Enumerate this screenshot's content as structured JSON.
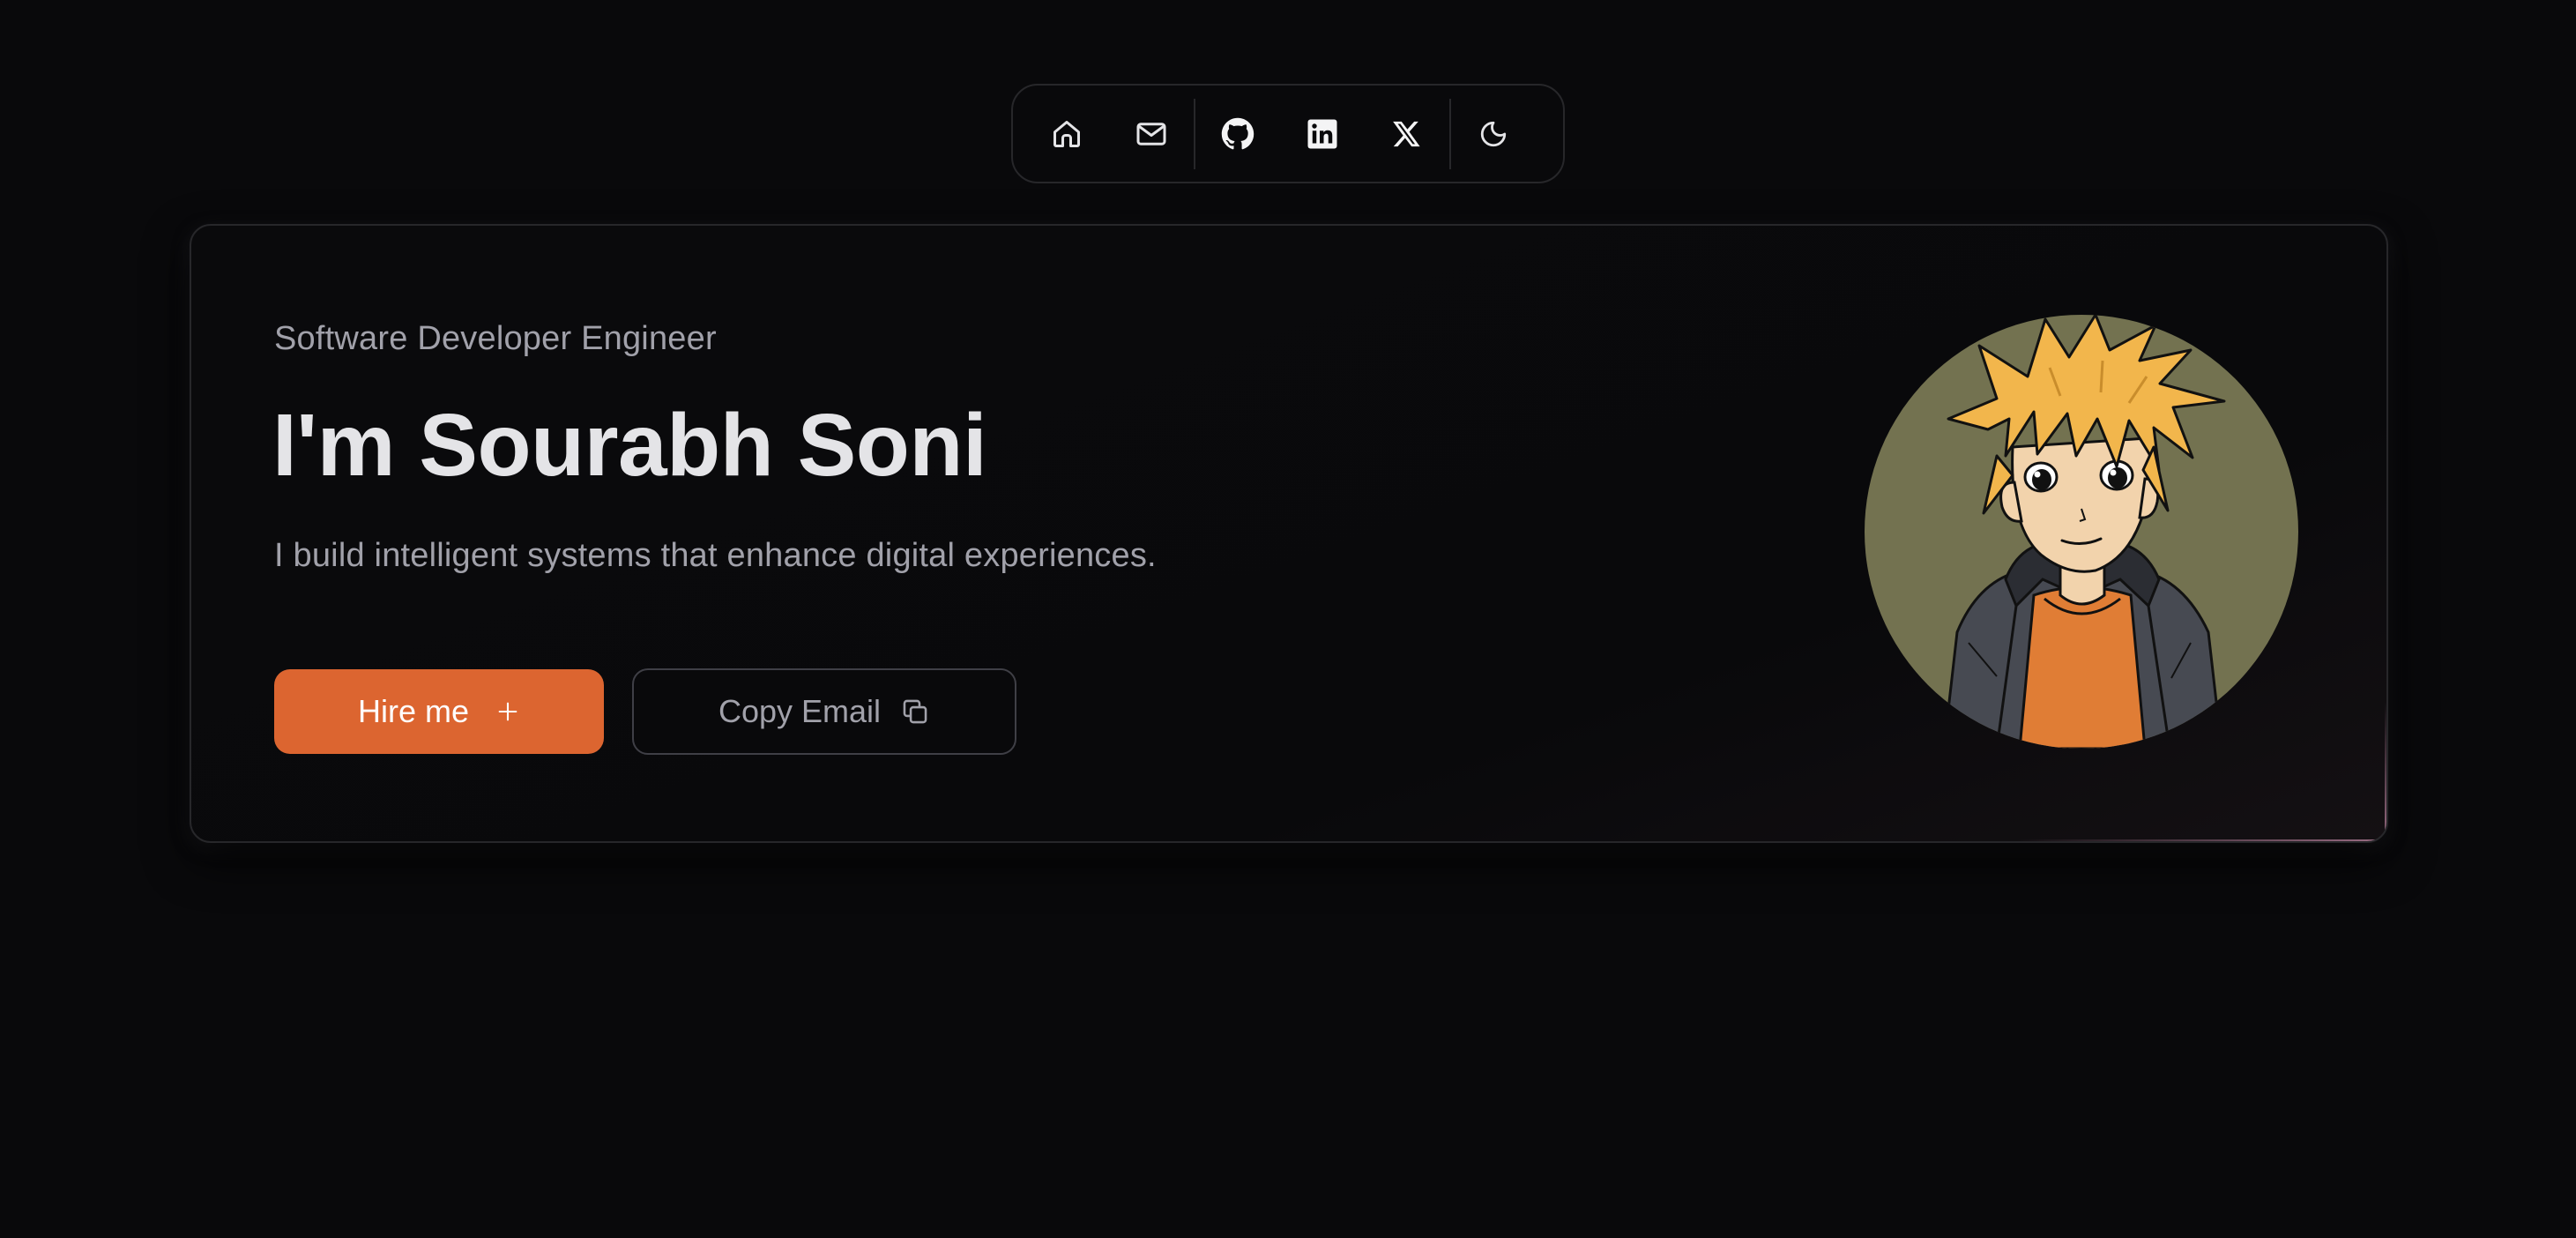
{
  "nav": {
    "items": [
      {
        "name": "home",
        "icon": "home-icon",
        "label": "Home"
      },
      {
        "name": "mail",
        "icon": "mail-icon",
        "label": "Email"
      },
      {
        "name": "github",
        "icon": "github-icon",
        "label": "GitHub"
      },
      {
        "name": "linkedin",
        "icon": "linkedin-icon",
        "label": "LinkedIn"
      },
      {
        "name": "x",
        "icon": "x-icon",
        "label": "X"
      },
      {
        "name": "theme",
        "icon": "moon-icon",
        "label": "Toggle theme"
      }
    ]
  },
  "hero": {
    "subtitle": "Software Developer Engineer",
    "title": "I'm Sourabh Soni",
    "tagline": "I build intelligent systems that enhance digital experiences.",
    "hire_label": "Hire me",
    "copy_label": "Copy Email",
    "avatar_icon": "anime-avatar"
  },
  "colors": {
    "background": "#09090b",
    "accent": "#dc6530",
    "border": "#27272a",
    "text_primary": "#e4e4e7",
    "text_muted": "#a1a1aa"
  }
}
